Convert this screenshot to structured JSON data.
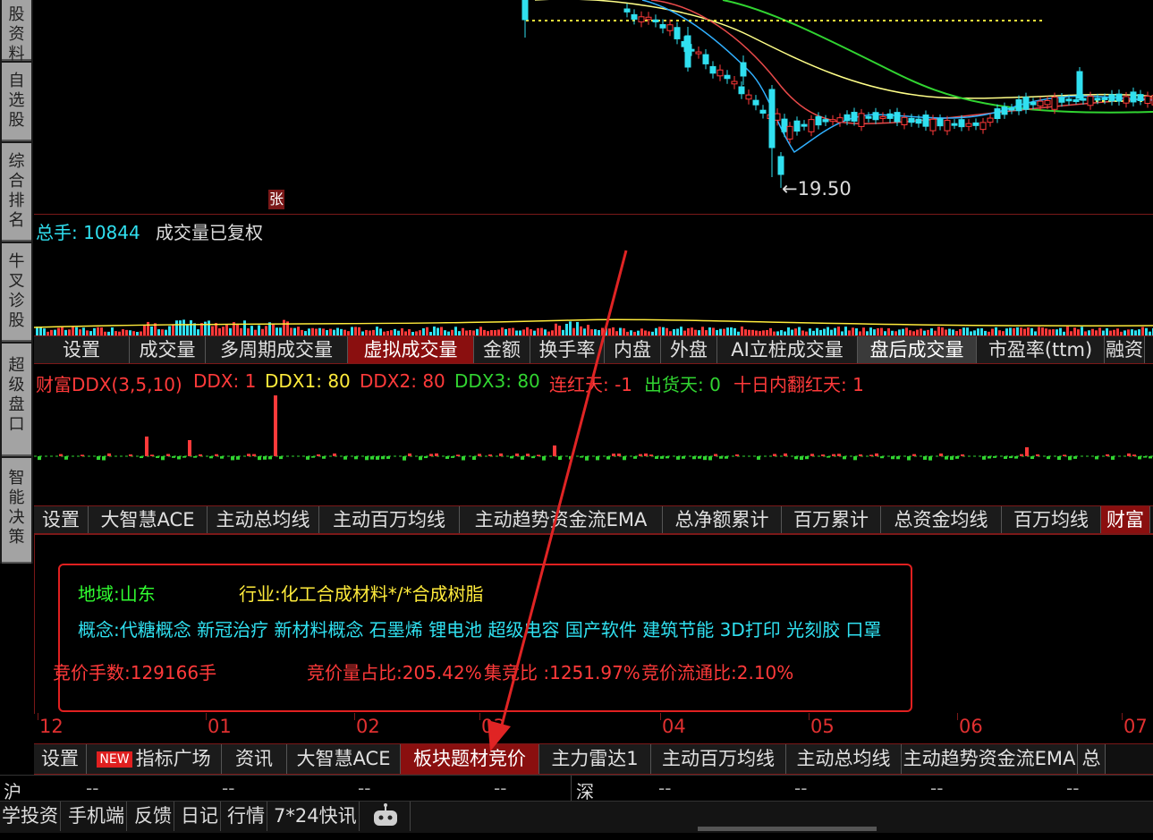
{
  "sidebar": {
    "items": [
      {
        "label": "股资料"
      },
      {
        "label": "自选股"
      },
      {
        "label": "综合排名"
      },
      {
        "label": "牛叉诊股"
      },
      {
        "label": "超级盘口"
      },
      {
        "label": "智能决策"
      }
    ]
  },
  "price_chart": {
    "low_marker": "←19.50",
    "zhang_badge": "张"
  },
  "volume_panel": {
    "label_total": "总手: 10844",
    "label_note": "成交量已复权"
  },
  "volume_tabs": [
    "设置",
    "成交量",
    "多周期成交量",
    "虚拟成交量",
    "金额",
    "换手率",
    "内盘",
    "外盘",
    "AI立桩成交量",
    "盘后成交量",
    "市盈率(ttm)",
    "融资"
  ],
  "ddx_header": {
    "title": "财富DDX(3,5,10)",
    "ddx": "DDX: 1",
    "ddx1": "DDX1: 80",
    "ddx2": "DDX2: 80",
    "ddx3": "DDX3: 80",
    "lianhong": "连红天: -1",
    "chuhuo": "出货天: 0",
    "shiri": "十日内翻红天: 1"
  },
  "ddx_tabs": [
    "设置",
    "大智慧ACE",
    "主动总均线",
    "主动百万均线",
    "主动趋势资金流EMA",
    "总净额累计",
    "百万累计",
    "总资金均线",
    "百万均线",
    "财富"
  ],
  "info": {
    "region": "地域:山东",
    "industry": "行业:化工合成材料*/*合成树脂",
    "concepts": "概念:代糖概念 新冠治疗 新材料概念 石墨烯 锂电池 超级电容 国产软件 建筑节能 3D打印 光刻胶 口罩",
    "auction_lots": "竞价手数:129166手",
    "auction_ratio": "竞价量占比:205.42%",
    "jingbi": "集竞比 :1251.97%",
    "float_ratio": "竞价流通比:2.10%"
  },
  "months": [
    "12",
    "01",
    "02",
    "03",
    "04",
    "05",
    "06",
    "07"
  ],
  "bottom_tabs": {
    "new_badge": "NEW",
    "items": [
      "设置",
      "指标广场",
      "资讯",
      "大智慧ACE",
      "板块题材竞价",
      "主力雷达1",
      "主动百万均线",
      "主动总均线",
      "主动趋势资金流EMA",
      "总"
    ]
  },
  "status_bar": {
    "sh": "沪",
    "sz": "深",
    "dash": "--"
  },
  "footer": {
    "items": [
      "学投资",
      "手机端",
      "反馈",
      "日记",
      "行情",
      "7*24快讯"
    ]
  },
  "colors": {
    "up": "#ff3a3a",
    "down": "#30e0f0",
    "ma5": "#ffffff",
    "ma10": "#ffeb3b",
    "ma20": "#e84a4a",
    "ma30": "#31d431",
    "ma60": "#ffff88",
    "arrow": "#e02424"
  }
}
